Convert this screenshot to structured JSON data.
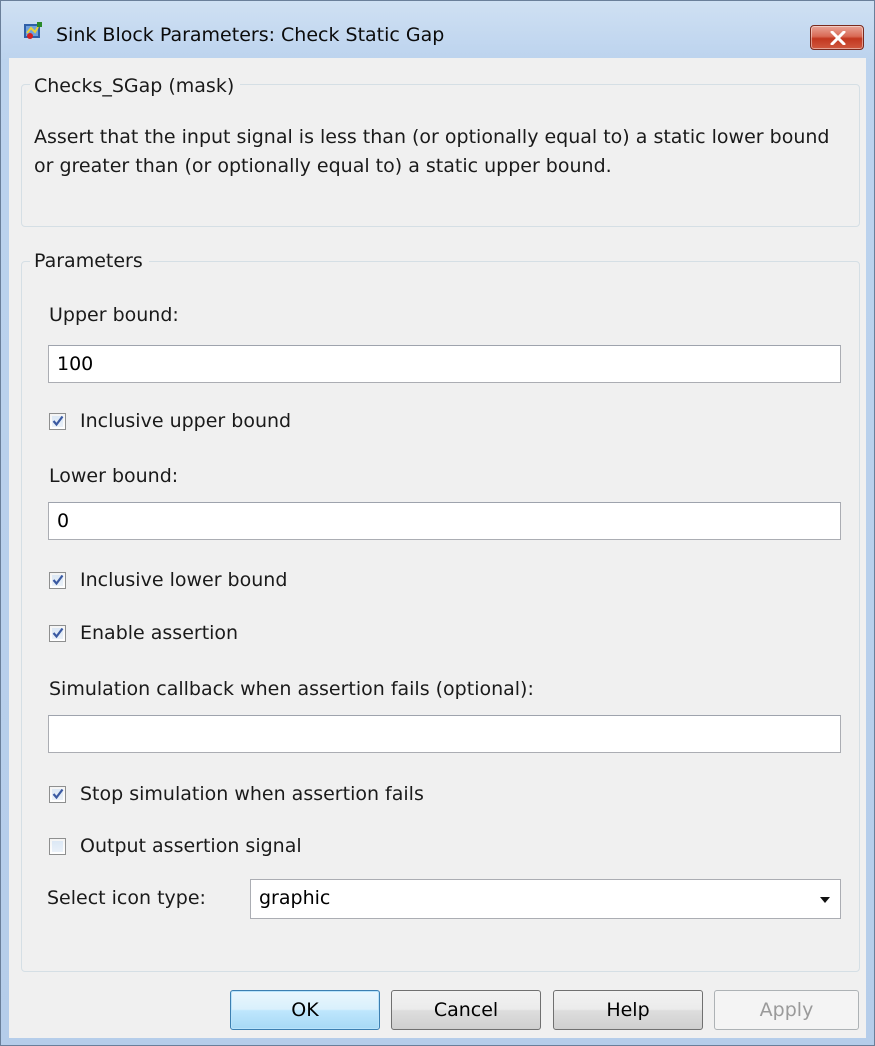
{
  "window": {
    "title": "Sink Block Parameters: Check Static Gap",
    "icon": "simulink-block-icon",
    "close_icon": "close-x-icon"
  },
  "mask_group": {
    "legend": "Checks_SGap (mask)",
    "description": "Assert that the input signal is less than (or optionally equal to) a static lower bound or greater than (or optionally equal to) a static upper bound."
  },
  "parameters": {
    "legend": "Parameters",
    "upper_bound_label": "Upper bound:",
    "upper_bound_value": "100",
    "inclusive_upper_label": "Inclusive upper bound",
    "inclusive_upper_checked": true,
    "lower_bound_label": "Lower bound:",
    "lower_bound_value": "0",
    "inclusive_lower_label": "Inclusive lower bound",
    "inclusive_lower_checked": true,
    "enable_assertion_label": "Enable assertion",
    "enable_assertion_checked": true,
    "callback_label": "Simulation callback when assertion fails (optional):",
    "callback_value": "",
    "stop_sim_label": "Stop simulation when assertion fails",
    "stop_sim_checked": true,
    "output_signal_label": "Output assertion signal",
    "output_signal_checked": false,
    "icon_type_label": "Select icon type:",
    "icon_type_value": "graphic"
  },
  "buttons": {
    "ok": "OK",
    "cancel": "Cancel",
    "help": "Help",
    "apply": "Apply"
  },
  "colors": {
    "title_bar": "#bcd3ee",
    "close_button": "#c2371f",
    "dialog_background": "#f0f0f0",
    "default_button": "#bee6fd"
  }
}
